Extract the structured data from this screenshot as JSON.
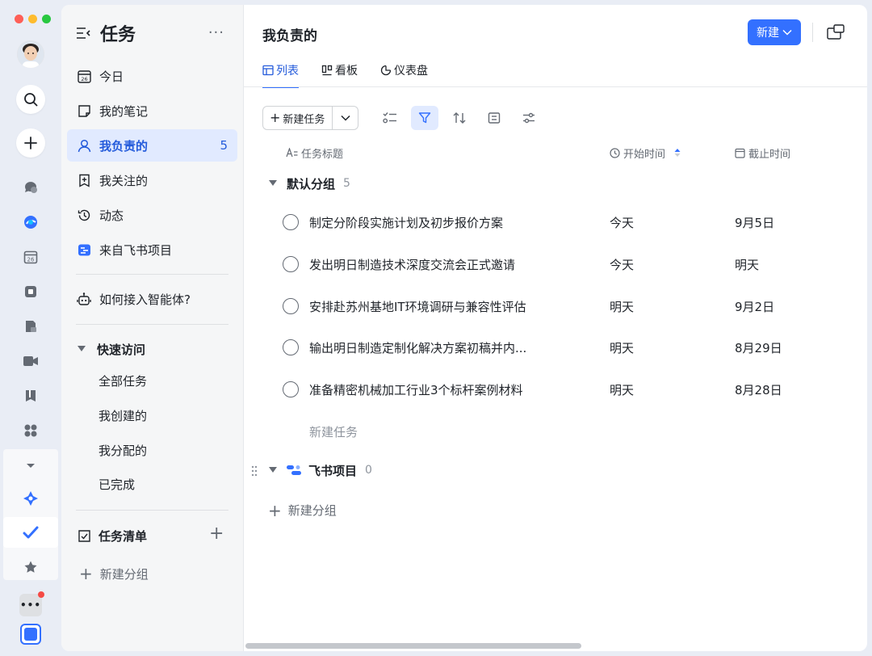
{
  "colors": {
    "accent": "#3370ff",
    "accent_text": "#245bdb",
    "active_bg": "#e1eaff",
    "traffic_red": "#fe5f57",
    "traffic_yellow": "#febc2e",
    "traffic_green": "#28c840"
  },
  "rail": {
    "icons": [
      "search-icon",
      "plus-icon",
      "messenger-icon",
      "cloud-icon",
      "calendar-icon",
      "workplace-icon",
      "docs-icon",
      "video-icon",
      "book-icon",
      "apps-icon",
      "chevron-down-icon",
      "ai-star-icon",
      "tasks-check-icon",
      "star-icon",
      "more-icon",
      "tenant-icon"
    ]
  },
  "sidebar": {
    "title": "任务",
    "more": "···",
    "items": [
      {
        "label": "今日",
        "icon": "calendar-today-icon"
      },
      {
        "label": "我的笔记",
        "icon": "note-icon"
      },
      {
        "label": "我负责的",
        "icon": "person-icon",
        "count": "5",
        "active": true
      },
      {
        "label": "我关注的",
        "icon": "follow-icon"
      },
      {
        "label": "动态",
        "icon": "history-icon"
      },
      {
        "label": "来自飞书项目",
        "icon": "project-icon"
      }
    ],
    "agent_item": "如何接入智能体?",
    "quick_access": {
      "title": "快速访问",
      "items": [
        "全部任务",
        "我创建的",
        "我分配的",
        "已完成"
      ]
    },
    "task_lists": {
      "title": "任务清单",
      "add": "+"
    },
    "new_group": "新建分组"
  },
  "main": {
    "title": "我负责的",
    "new_button": "新建",
    "tabs": [
      {
        "label": "列表",
        "icon": "list-icon",
        "active": true
      },
      {
        "label": "看板",
        "icon": "board-icon"
      },
      {
        "label": "仪表盘",
        "icon": "dashboard-icon"
      }
    ],
    "toolbar": {
      "new_task": "新建任务"
    },
    "columns": {
      "title": "任务标题",
      "start": "开始时间",
      "due": "截止时间"
    },
    "groups": [
      {
        "name": "默认分组",
        "count": "5",
        "tasks": [
          {
            "title": "制定分阶段实施计划及初步报价方案",
            "start": "今天",
            "due": "9月5日"
          },
          {
            "title": "发出明日制造技术深度交流会正式邀请",
            "start": "今天",
            "due": "明天"
          },
          {
            "title": "安排赴苏州基地IT环境调研与兼容性评估",
            "start": "明天",
            "due": "9月2日"
          },
          {
            "title": "输出明日制造定制化解决方案初稿并内...",
            "start": "明天",
            "due": "8月29日"
          },
          {
            "title": "准备精密机械加工行业3个标杆案例材料",
            "start": "明天",
            "due": "8月28日"
          }
        ],
        "new_task": "新建任务"
      },
      {
        "name": "飞书项目",
        "count": "0"
      }
    ],
    "new_group": "新建分组"
  }
}
